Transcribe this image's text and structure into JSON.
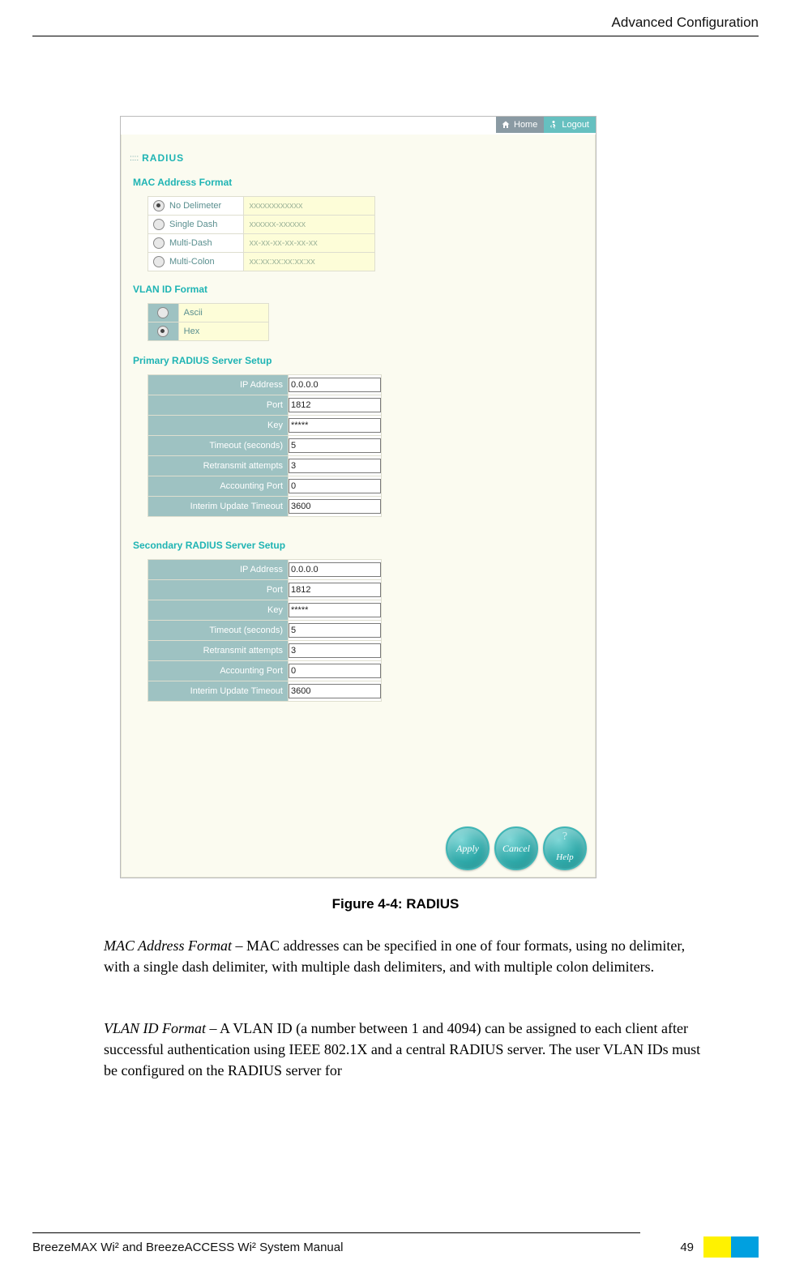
{
  "header": {
    "section": "Advanced Configuration"
  },
  "shot": {
    "topbar": {
      "home": "Home",
      "logout": "Logout"
    },
    "title": "RADIUS",
    "mac_heading": "MAC Address Format",
    "mac_rows": [
      {
        "label": "No Delimeter",
        "example": "xxxxxxxxxxxx",
        "checked": true
      },
      {
        "label": "Single Dash",
        "example": "xxxxxx-xxxxxx",
        "checked": false
      },
      {
        "label": "Multi-Dash",
        "example": "xx-xx-xx-xx-xx-xx",
        "checked": false
      },
      {
        "label": "Multi-Colon",
        "example": "xx:xx:xx:xx:xx:xx",
        "checked": false
      }
    ],
    "vlan_heading": "VLAN ID Format",
    "vlan_rows": [
      {
        "label": "Ascii",
        "checked": false
      },
      {
        "label": "Hex",
        "checked": true
      }
    ],
    "primary_heading": "Primary RADIUS Server Setup",
    "secondary_heading": "Secondary RADIUS Server Setup",
    "srv_fields": [
      {
        "label": "IP Address",
        "key": "ip"
      },
      {
        "label": "Port",
        "key": "port"
      },
      {
        "label": "Key",
        "key": "key"
      },
      {
        "label": "Timeout (seconds)",
        "key": "timeout"
      },
      {
        "label": "Retransmit attempts",
        "key": "retransmit"
      },
      {
        "label": "Accounting Port",
        "key": "acct"
      },
      {
        "label": "Interim Update Timeout",
        "key": "interim"
      }
    ],
    "primary": {
      "ip": "0.0.0.0",
      "port": "1812",
      "key": "*****",
      "timeout": "5",
      "retransmit": "3",
      "acct": "0",
      "interim": "3600"
    },
    "secondary": {
      "ip": "0.0.0.0",
      "port": "1812",
      "key": "*****",
      "timeout": "5",
      "retransmit": "3",
      "acct": "0",
      "interim": "3600"
    },
    "buttons": {
      "apply": "Apply",
      "cancel": "Cancel",
      "help": "Help"
    }
  },
  "caption": "Figure 4-4: RADIUS",
  "body": {
    "p1_lead": "MAC Address Format",
    "p1_rest": " – MAC addresses can be specified in one of four formats, using no delimiter, with a single dash delimiter, with multiple dash delimiters, and with multiple colon delimiters.",
    "p2_lead": "VLAN ID Format",
    "p2_rest": " – A VLAN ID (a number between 1 and 4094) can be assigned to each client after successful authentication using IEEE 802.1X and a central RADIUS server. The user VLAN IDs must be configured on the RADIUS server for"
  },
  "footer": {
    "left": "BreezeMAX Wi² and BreezeACCESS Wi² System Manual",
    "page": "49"
  }
}
